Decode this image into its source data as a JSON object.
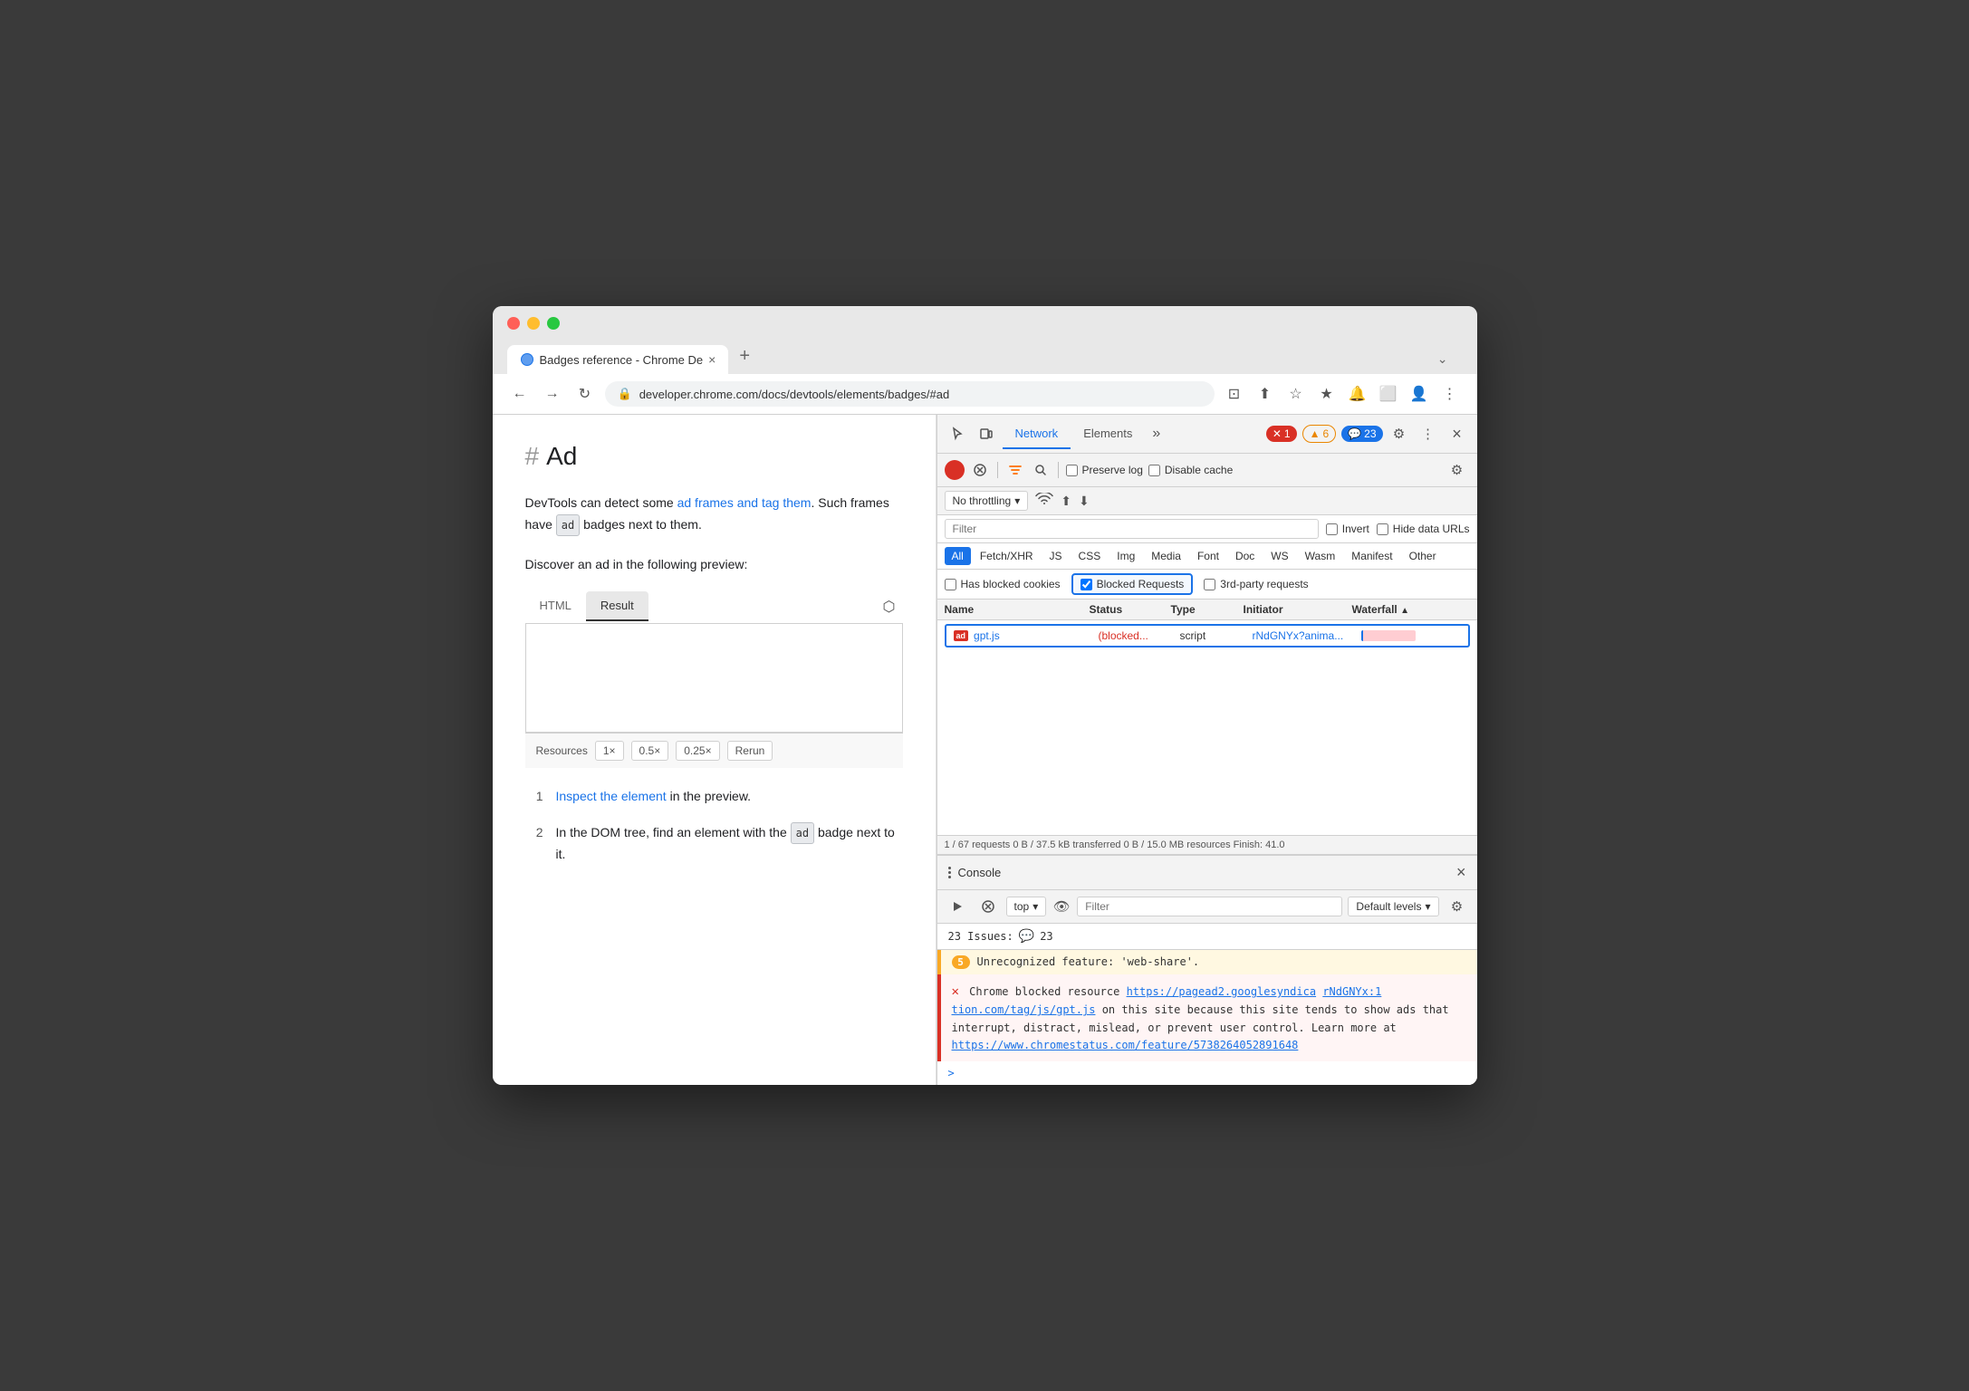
{
  "browser": {
    "traffic_lights": [
      "red",
      "yellow",
      "green"
    ],
    "tab": {
      "favicon_color": "#1a73e8",
      "label": "Badges reference - Chrome De",
      "close_icon": "×"
    },
    "new_tab_icon": "+",
    "more_icon": "⌄",
    "nav": {
      "back_icon": "←",
      "forward_icon": "→",
      "reload_icon": "↻"
    },
    "url": "developer.chrome.com/docs/devtools/elements/badges/#ad",
    "address_icons": [
      "⊡",
      "⬆",
      "☆",
      "★",
      "🔔",
      "⬜",
      "👤",
      "⋮"
    ]
  },
  "page": {
    "hash_symbol": "#",
    "heading": "Ad",
    "paragraph1_start": "DevTools can detect some ",
    "paragraph1_link1": "ad frames and tag them",
    "paragraph1_mid": ". Such frames have ",
    "paragraph1_badge": "ad",
    "paragraph1_end": " badges next to them.",
    "paragraph2": "Discover an ad in the following preview:",
    "preview_tabs": [
      {
        "label": "HTML",
        "active": false
      },
      {
        "label": "Result",
        "active": true
      }
    ],
    "preview_tab_icon": "⬡",
    "resources_label": "Resources",
    "preview_controls": [
      "1×",
      "0.5×",
      "0.25×",
      "Rerun"
    ],
    "steps": [
      {
        "num": "1",
        "text_start": "",
        "link": "Inspect the element",
        "text_end": " in the preview."
      },
      {
        "num": "2",
        "text": "In the DOM tree, find an element with the ",
        "badge": "ad",
        "text_end": " badge next to it."
      }
    ]
  },
  "devtools": {
    "header": {
      "cursor_icon": "⊹",
      "device_icon": "⬜",
      "tabs": [
        "Network",
        "Elements"
      ],
      "active_tab": "Network",
      "more_icon": "»",
      "badges": {
        "error": {
          "count": "1",
          "icon": "✕"
        },
        "warning": {
          "count": "6",
          "icon": "▲"
        },
        "info": {
          "count": "23",
          "icon": "💬"
        }
      },
      "settings_icon": "⚙",
      "menu_icon": "⋮",
      "close_icon": "×"
    },
    "network": {
      "toolbar": {
        "record_icon": "●",
        "clear_icon": "⊘",
        "filter_icon": "▽",
        "search_icon": "🔍",
        "preserve_log_label": "Preserve log",
        "disable_cache_label": "Disable cache",
        "settings_icon": "⚙"
      },
      "filter_row": {
        "throttle_label": "No throttling",
        "throttle_icon": "▾",
        "wifi_icon": "≈",
        "upload_icon": "⬆",
        "download_icon": "⬇"
      },
      "filter_bar": {
        "placeholder": "Filter",
        "invert_label": "Invert",
        "hide_data_urls_label": "Hide data URLs"
      },
      "type_filters": [
        "All",
        "Fetch/XHR",
        "JS",
        "CSS",
        "Img",
        "Media",
        "Font",
        "Doc",
        "WS",
        "Wasm",
        "Manifest",
        "Other"
      ],
      "active_type": "All",
      "blocked_row": {
        "has_blocked_cookies": "Has blocked cookies",
        "blocked_requests": "Blocked Requests",
        "blocked_checked": true,
        "third_party": "3rd-party requests"
      },
      "table": {
        "headers": [
          "Name",
          "Status",
          "Type",
          "Initiator",
          "Waterfall"
        ],
        "rows": [
          {
            "ad_badge": "ad",
            "name": "gpt.js",
            "status": "(blocked...",
            "type": "script",
            "initiator": "rNdGNYx?anima...",
            "has_waterfall": true
          }
        ]
      },
      "status_bar": "1 / 67 requests   0 B / 37.5 kB transferred   0 B / 15.0 MB resources   Finish: 41.0"
    },
    "console": {
      "header_title": "Console",
      "close_icon": "×",
      "toolbar": {
        "run_icon": "▶",
        "clear_icon": "⊘",
        "context_label": "top",
        "context_icon": "▾",
        "eye_icon": "👁",
        "filter_placeholder": "Filter",
        "levels_label": "Default levels",
        "levels_icon": "▾",
        "settings_icon": "⚙"
      },
      "issues_banner": "23 Issues:  💬 23",
      "messages": [
        {
          "type": "warning",
          "badge": "5",
          "text": "Unrecognized feature: 'web-share'."
        },
        {
          "type": "error",
          "text_start": "Chrome blocked resource ",
          "link1": "https://pagead2.googlesyndica",
          "link1_right": "rNdGNYx:1",
          "link2": "tion.com/tag/js/gpt.js",
          "text_mid": " on this site because this site tends to show ads that interrupt, distract, mislead, or prevent user control. Learn more at ",
          "link3": "https://www.chromestatus.com/feature/5738264052891648"
        }
      ],
      "prompt_chevron": ">"
    }
  }
}
